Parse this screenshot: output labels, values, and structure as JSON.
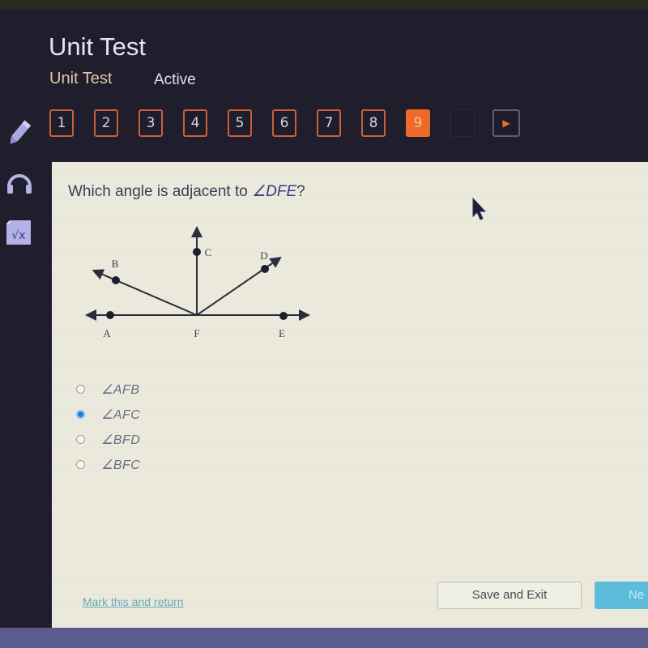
{
  "header": {
    "title": "Unit Test",
    "subtitle": "Unit Test",
    "status": "Active"
  },
  "tools": [
    {
      "name": "pencil-icon"
    },
    {
      "name": "headphones-icon"
    },
    {
      "name": "calculator-sqrt-icon",
      "glyph": "√x"
    }
  ],
  "question_nav": {
    "items": [
      "1",
      "2",
      "3",
      "4",
      "5",
      "6",
      "7",
      "8",
      "9"
    ],
    "current": "9",
    "next_glyph": "▶"
  },
  "question": {
    "prompt": "Which angle is adjacent to ",
    "angle": "∠DFE",
    "suffix": "?"
  },
  "diagram": {
    "points": [
      "A",
      "B",
      "C",
      "D",
      "E",
      "F"
    ],
    "labels": {
      "A": "A",
      "B": "B",
      "C": "C",
      "D": "D",
      "E": "E",
      "F": "F"
    }
  },
  "answers": {
    "options": [
      "∠AFB",
      "∠AFC",
      "∠BFD",
      "∠BFC"
    ],
    "selected_index": 1
  },
  "footer": {
    "mark_link": "Mark this and return",
    "save_button": "Save and Exit",
    "next_button": "Ne"
  },
  "colors": {
    "accent_orange": "#ee6a2a",
    "next_button": "#5cbcda",
    "radio_selected": "#1a7fe0",
    "header_bg": "#201e2d",
    "card_bg": "#ecebdd"
  }
}
